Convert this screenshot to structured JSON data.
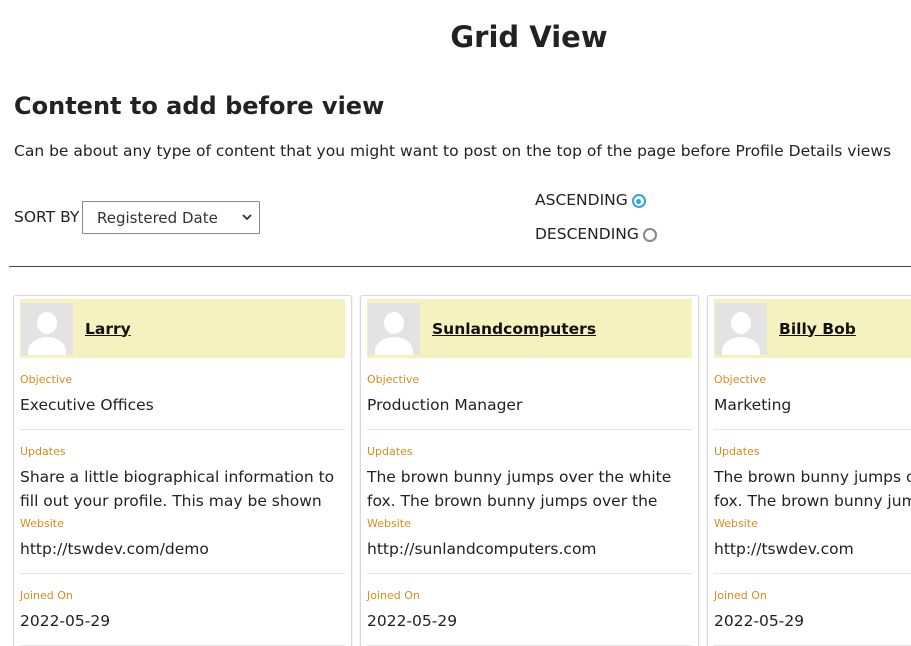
{
  "page": {
    "title": "Grid View",
    "section_heading": "Content to add before view",
    "intro_text": "Can be about any type of content that you might want to post on the top of the page before Profile Details views"
  },
  "sort": {
    "label": "SORT BY",
    "selected": "Registered Date",
    "ascending_label": "ASCENDING",
    "descending_label": "DESCENDING",
    "order": "ascending"
  },
  "colors": {
    "card_header_bg": "#f5f2bf",
    "field_label": "#d98b1c",
    "radio_accent": "#2aa7d8"
  },
  "field_labels": {
    "objective": "Objective",
    "updates": "Updates",
    "website": "Website",
    "joined": "Joined On"
  },
  "profiles": [
    {
      "name": "Larry",
      "objective": "Executive Offices",
      "updates": "Share a little biographical information to fill out your profile. This may be shown publicly. Share",
      "website": "http://tswdev.com/demo",
      "joined": "2022-05-29"
    },
    {
      "name": "Sunlandcomputers",
      "objective": "Production Manager",
      "updates": "The brown bunny jumps over the white fox. The brown bunny jumps over the white fox.",
      "website": "http://sunlandcomputers.com",
      "joined": "2022-05-29"
    },
    {
      "name": "Billy Bob",
      "objective": "Marketing",
      "updates": "The brown bunny jumps over the white fox. The brown bunny jumps over the white fox.",
      "website": "http://tswdev.com",
      "joined": "2022-05-29"
    }
  ]
}
